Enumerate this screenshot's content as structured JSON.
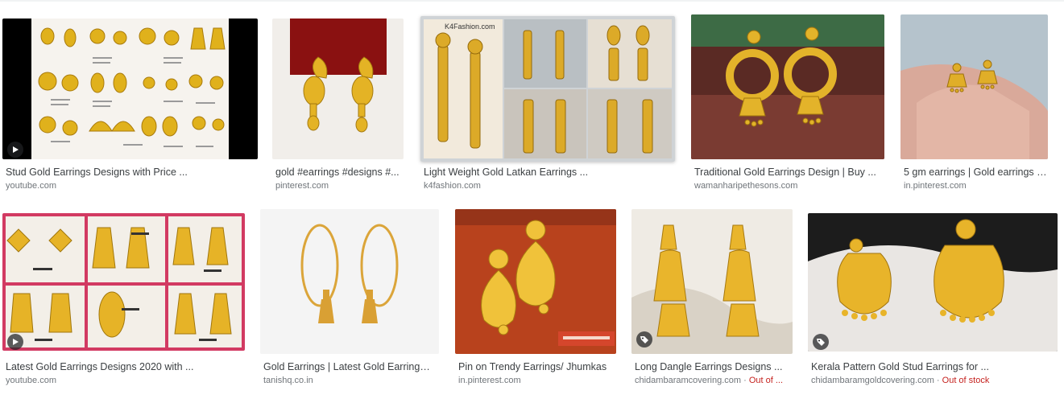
{
  "colors": {
    "title_text": "#3c4043",
    "source_text": "#70757a",
    "out_of_stock": "#c5221f",
    "badge_bg": "#202124"
  },
  "results": [
    {
      "title": "Stud Gold Earrings Designs with Price ...",
      "source": "youtube.com",
      "badge": "play-icon"
    },
    {
      "title": "gold #earrings #designs #...",
      "source": "pinterest.com"
    },
    {
      "title": "Light Weight Gold Latkan Earrings ...",
      "source": "k4fashion.com",
      "watermark": "K4Fashion.com"
    },
    {
      "title": "Traditional Gold Earrings Design | Buy ...",
      "source": "wamanharipethesons.com"
    },
    {
      "title": "5 gm earrings | Gold earrings de...",
      "source": "in.pinterest.com"
    },
    {
      "title": "Latest Gold Earrings Designs 2020 with ...",
      "source": "youtube.com",
      "badge": "play-icon"
    },
    {
      "title": "Gold Earrings | Latest Gold Earrings ...",
      "source": "tanishq.co.in"
    },
    {
      "title": "Pin on Trendy Earrings/ Jhumkas",
      "source": "in.pinterest.com"
    },
    {
      "title": "Long Dangle Earrings Designs ...",
      "source": "chidambaramcovering.com",
      "separator": " · ",
      "stock": "Out of ...",
      "badge": "tag-icon"
    },
    {
      "title": "Kerala Pattern Gold Stud Earrings for ...",
      "source": "chidambaramgoldcovering.com",
      "separator": " · ",
      "stock": "Out of stock",
      "badge": "tag-icon"
    }
  ]
}
